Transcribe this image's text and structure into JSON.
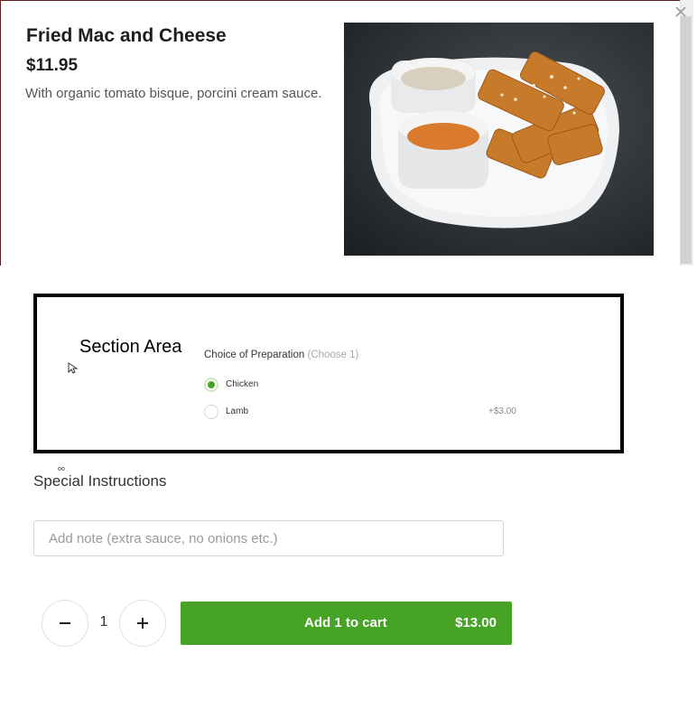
{
  "item": {
    "title": "Fried Mac and Cheese",
    "price": "$11.95",
    "description": "With organic tomato bisque, porcini cream sauce.",
    "image_alt": "fried-mac-and-cheese-sticks-with-dipping-sauces"
  },
  "section": {
    "label": "Section Area",
    "choice_title": "Choice of Preparation",
    "choice_hint": "(Choose 1)",
    "options": [
      {
        "label": "Chicken",
        "price": "",
        "selected": true
      },
      {
        "label": "Lamb",
        "price": "+$3.00",
        "selected": false
      }
    ],
    "tiny_mark": "oo"
  },
  "special_instructions": {
    "label": "Special Instructions",
    "placeholder": "Add note (extra sauce, no onions etc.)",
    "value": ""
  },
  "cart": {
    "quantity": "1",
    "add_label": "Add 1 to cart",
    "total": "$13.00"
  },
  "icons": {
    "close": "close-icon",
    "minus": "minus-icon",
    "plus": "plus-icon",
    "cursor": "mouse-pointer-icon"
  },
  "colors": {
    "accent": "#47a325",
    "border_box": "#000000"
  }
}
